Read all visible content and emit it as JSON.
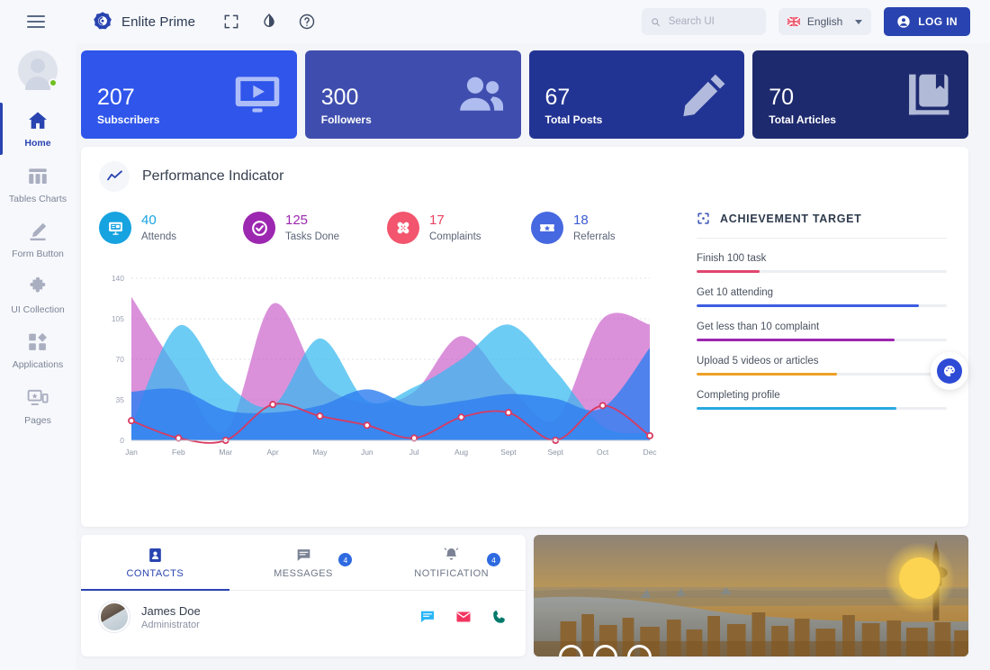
{
  "topbar": {
    "menu_icon": "hamburger-icon",
    "brand": "Enlite Prime",
    "fullscreen_icon": "fullscreen-icon",
    "contrast_icon": "contrast-icon",
    "help_icon": "help-circle-icon",
    "search_placeholder": "Search UI",
    "search_value": "",
    "language": "English",
    "login_label": "LOG IN"
  },
  "sidebar": {
    "status": "online",
    "items": [
      {
        "label": "Home",
        "icon": "home-icon",
        "active": true
      },
      {
        "label": "Tables Charts",
        "icon": "table-icon",
        "active": false
      },
      {
        "label": "Form Button",
        "icon": "pencil-icon",
        "active": false
      },
      {
        "label": "UI Collection",
        "icon": "puzzle-icon",
        "active": false
      },
      {
        "label": "Applications",
        "icon": "apps-grid-icon",
        "active": false
      },
      {
        "label": "Pages",
        "icon": "pages-icon",
        "active": false
      }
    ]
  },
  "stats": [
    {
      "value": "207",
      "label": "Subscribers",
      "color": "#2f55ea",
      "icon": "monitor-play-icon"
    },
    {
      "value": "300",
      "label": "Followers",
      "color": "#3f4eae",
      "icon": "people-icon"
    },
    {
      "value": "67",
      "label": "Total Posts",
      "color": "#223493",
      "icon": "pencil-icon"
    },
    {
      "value": "70",
      "label": "Total Articles",
      "color": "#1e2a6e",
      "icon": "book-bookmark-icon"
    }
  ],
  "performance": {
    "title": "Performance Indicator",
    "header_icon": "trend-line-icon",
    "kpis": [
      {
        "value": "40",
        "label": "Attends",
        "color": "#17a3e0",
        "text_color": "#17a3e0",
        "icon": "presentation-icon"
      },
      {
        "value": "125",
        "label": "Tasks Done",
        "color": "#9c27b0",
        "text_color": "#9c27b0",
        "icon": "check-circle-icon"
      },
      {
        "value": "17",
        "label": "Complaints",
        "color": "#f2556d",
        "text_color": "#e8415f",
        "icon": "bandage-icon"
      },
      {
        "value": "18",
        "label": "Referrals",
        "color": "#4668e0",
        "text_color": "#3b5bd4",
        "icon": "ticket-star-icon"
      }
    ]
  },
  "chart_data": {
    "type": "area",
    "title": "Performance Indicator",
    "xlabel": "",
    "ylabel": "",
    "ylim": [
      0,
      140
    ],
    "yticks": [
      0,
      35,
      70,
      105,
      140
    ],
    "grid": true,
    "legend": "none",
    "categories": [
      "Jan",
      "Feb",
      "Mar",
      "Apr",
      "May",
      "Jun",
      "Jul",
      "Aug",
      "Sept",
      "Sept",
      "Oct",
      "Dec"
    ],
    "series": [
      {
        "name": "Magenta area",
        "type": "area",
        "color": "#c34ec4",
        "fill_opacity": 0.62,
        "values": [
          124,
          60,
          8,
          118,
          52,
          32,
          42,
          90,
          48,
          18,
          105,
          100
        ]
      },
      {
        "name": "Light blue area",
        "type": "area",
        "color": "#35b8f0",
        "fill_opacity": 0.72,
        "values": [
          12,
          99,
          50,
          30,
          88,
          34,
          46,
          70,
          100,
          60,
          12,
          6
        ]
      },
      {
        "name": "Blue area",
        "type": "area",
        "color": "#2f7ff0",
        "fill_opacity": 0.82,
        "values": [
          42,
          44,
          26,
          24,
          30,
          44,
          30,
          34,
          40,
          36,
          28,
          80
        ]
      },
      {
        "name": "Crimson line",
        "type": "line",
        "color": "#d83a62",
        "marker": "circle",
        "values": [
          17,
          2,
          0,
          31,
          21,
          13,
          2,
          20,
          24,
          0,
          30,
          4
        ]
      }
    ]
  },
  "achievement": {
    "title": "ACHIEVEMENT TARGET",
    "icon": "target-focus-icon",
    "items": [
      {
        "label": "Finish 100 task",
        "percent": 25,
        "color": "#e0466e"
      },
      {
        "label": "Get 10 attending",
        "percent": 89,
        "color": "#3c5de0"
      },
      {
        "label": "Get less than 10 complaint",
        "percent": 79,
        "color": "#9c27b0"
      },
      {
        "label": "Upload 5 videos or articles",
        "percent": 56,
        "color": "#efa025"
      },
      {
        "label": "Completing profile",
        "percent": 80,
        "color": "#29a8e0"
      }
    ]
  },
  "palette_fab": {
    "icon": "palette-icon"
  },
  "contacts_card": {
    "tabs": [
      {
        "label": "CONTACTS",
        "icon": "contact-card-icon",
        "badge": "",
        "active": true
      },
      {
        "label": "MESSAGES",
        "icon": "message-icon",
        "badge": "4",
        "active": false
      },
      {
        "label": "NOTIFICATION",
        "icon": "bell-icon",
        "badge": "4",
        "active": false
      }
    ],
    "contacts": [
      {
        "name": "James Doe",
        "role": "Administrator",
        "actions": [
          "chat-icon",
          "mail-icon",
          "phone-icon"
        ]
      }
    ]
  },
  "city_card": {
    "image_alt": "city-skyline-sunset",
    "sun_icon": "sun-icon",
    "rings": 3
  }
}
